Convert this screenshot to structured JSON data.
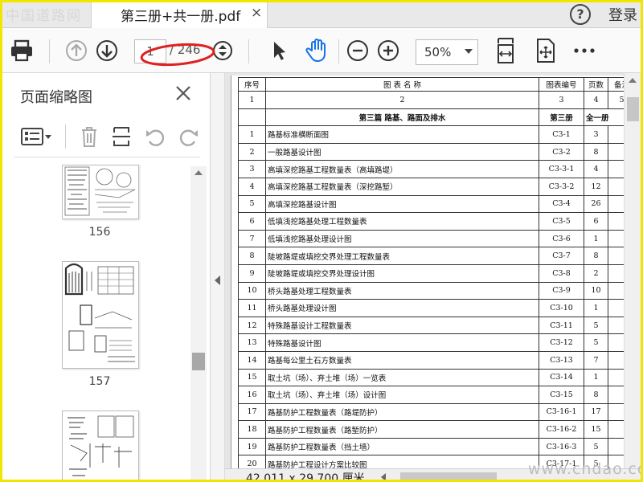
{
  "watermark_top": "中国道路网",
  "watermark_bottom": "www.cndao.com",
  "tab": {
    "title": "第三册+共一册.pdf",
    "close": "×"
  },
  "header": {
    "help": "?",
    "login": "登录"
  },
  "toolbar": {
    "page_current": "1",
    "page_total": "/ 246",
    "zoom": "50%"
  },
  "panel": {
    "title": "页面缩略图",
    "thumbs": [
      {
        "label": "156"
      },
      {
        "label": "157"
      },
      {
        "label": ""
      }
    ]
  },
  "table": {
    "headers": [
      "序号",
      "图 表 名 称",
      "图表编号",
      "页数",
      "备注"
    ],
    "index_row": [
      "1",
      "2",
      "3",
      "4",
      "5"
    ],
    "section": {
      "title": "第三篇  路基、路面及排水",
      "volume": "第三册",
      "total": "全一册"
    },
    "rows": [
      {
        "no": "1",
        "name": "路基标准横断面图",
        "code": "C3-1",
        "pages": "3",
        "note": ""
      },
      {
        "no": "2",
        "name": "一般路基设计图",
        "code": "C3-2",
        "pages": "8",
        "note": ""
      },
      {
        "no": "3",
        "name": "高填深挖路基工程数量表（高填路堤）",
        "code": "C3-3-1",
        "pages": "4",
        "note": ""
      },
      {
        "no": "4",
        "name": "高填深挖路基工程数量表（深挖路堑）",
        "code": "C3-3-2",
        "pages": "12",
        "note": ""
      },
      {
        "no": "5",
        "name": "高填深挖路基设计图",
        "code": "C3-4",
        "pages": "26",
        "note": ""
      },
      {
        "no": "6",
        "name": "低填浅挖路基处理工程数量表",
        "code": "C3-5",
        "pages": "6",
        "note": ""
      },
      {
        "no": "7",
        "name": "低填浅挖路基处理设计图",
        "code": "C3-6",
        "pages": "1",
        "note": ""
      },
      {
        "no": "8",
        "name": "陡坡路堤或填挖交界处理工程数量表",
        "code": "C3-7",
        "pages": "8",
        "note": ""
      },
      {
        "no": "9",
        "name": "陡坡路堤或填挖交界处理设计图",
        "code": "C3-8",
        "pages": "2",
        "note": ""
      },
      {
        "no": "10",
        "name": "桥头路基处理工程数量表",
        "code": "C3-9",
        "pages": "10",
        "note": ""
      },
      {
        "no": "11",
        "name": "桥头路基处理设计图",
        "code": "C3-10",
        "pages": "1",
        "note": ""
      },
      {
        "no": "12",
        "name": "特殊路基设计工程数量表",
        "code": "C3-11",
        "pages": "5",
        "note": ""
      },
      {
        "no": "13",
        "name": "特殊路基设计图",
        "code": "C3-12",
        "pages": "5",
        "note": ""
      },
      {
        "no": "14",
        "name": "路基每公里土石方数量表",
        "code": "C3-13",
        "pages": "7",
        "note": ""
      },
      {
        "no": "15",
        "name": "取土坑（场）、弃土堆（场）一览表",
        "code": "C3-14",
        "pages": "1",
        "note": ""
      },
      {
        "no": "16",
        "name": "取土坑（场）、弃土堆（场）设计图",
        "code": "C3-15",
        "pages": "8",
        "note": ""
      },
      {
        "no": "17",
        "name": "路基防护工程数量表（路堤防护）",
        "code": "C3-16-1",
        "pages": "17",
        "note": ""
      },
      {
        "no": "18",
        "name": "路基防护工程数量表（路堑防护）",
        "code": "C3-16-2",
        "pages": "15",
        "note": ""
      },
      {
        "no": "19",
        "name": "路基防护工程数量表（挡土墙）",
        "code": "C3-16-3",
        "pages": "5",
        "note": ""
      },
      {
        "no": "20",
        "name": "路基防护工程设计方案比较图",
        "code": "C3-17-1",
        "pages": "5",
        "note": ""
      }
    ]
  },
  "status": {
    "dimensions": "42.011 x 29.700 厘米"
  },
  "colors": {
    "frame": "#f2e600",
    "annotation": "#e02020",
    "hand_tool": "#1473e6"
  }
}
